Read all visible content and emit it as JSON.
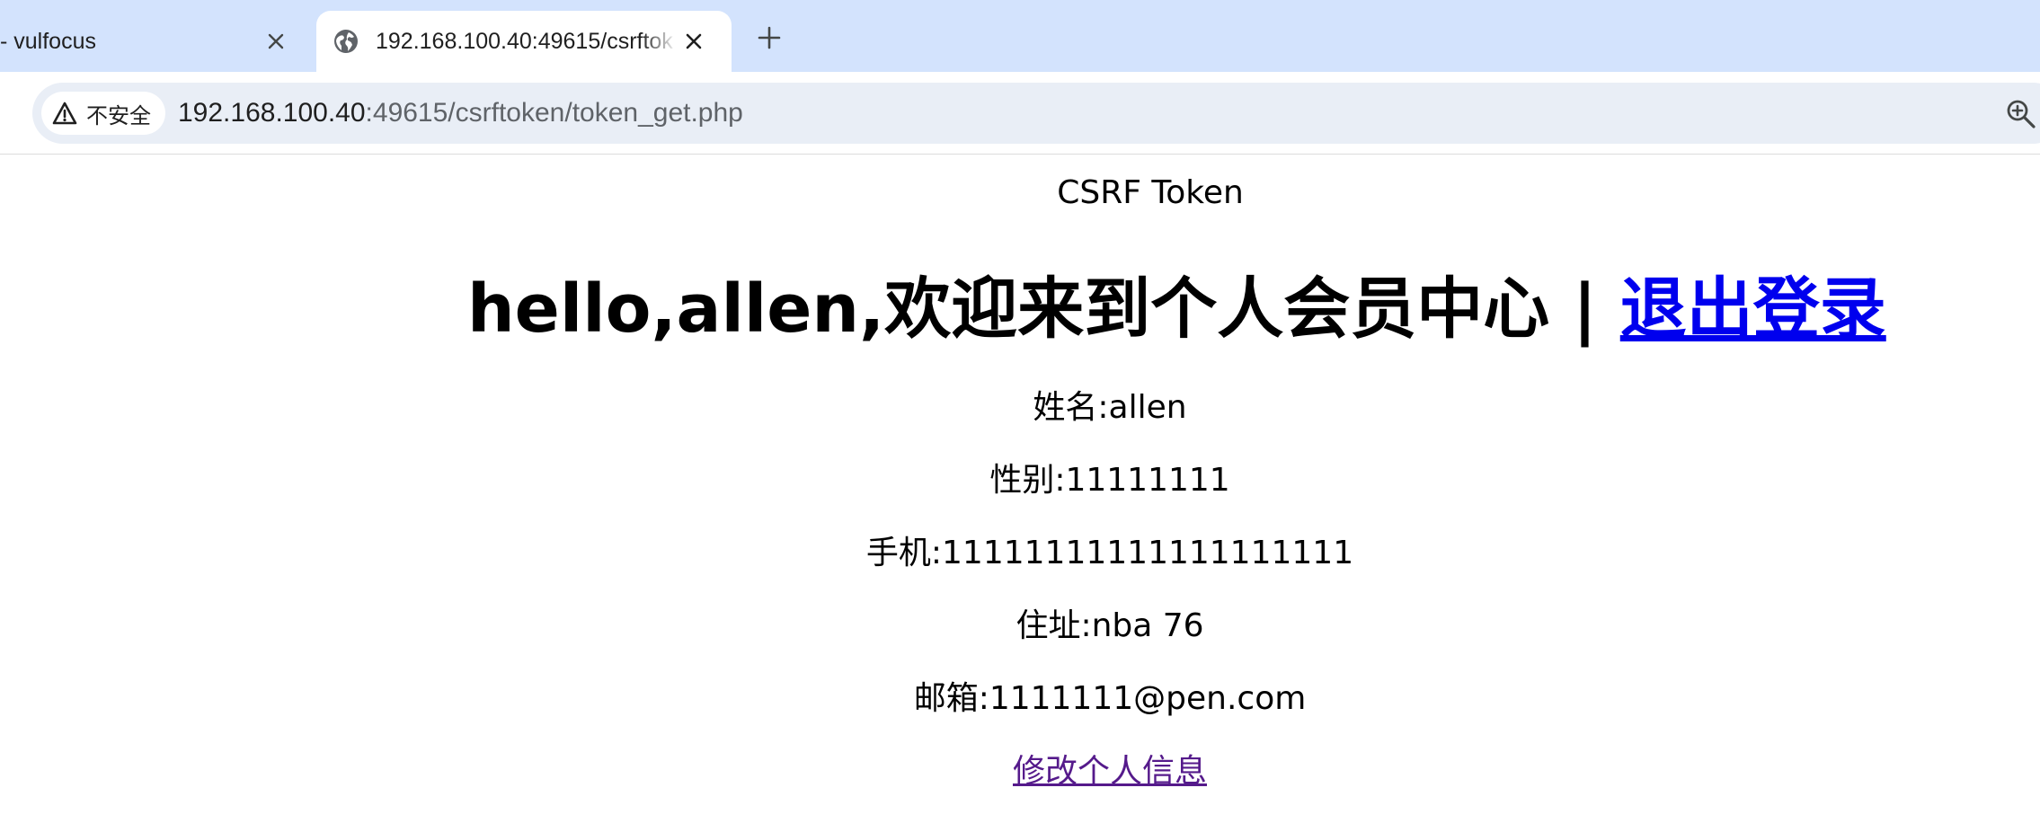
{
  "browser": {
    "tabs": [
      {
        "title": "- vulfocus",
        "active": false
      },
      {
        "title": "192.168.100.40:49615/csrftok",
        "active": true
      }
    ],
    "security_chip": "不安全",
    "url_host": "192.168.100.40",
    "url_rest": ":49615/csrftoken/token_get.php",
    "icons": {
      "close": "close-icon",
      "globe": "globe-icon",
      "new_tab": "plus-icon",
      "warning": "warning-icon",
      "zoom": "zoom-in-icon",
      "menu": "chevron-down-icon"
    }
  },
  "page": {
    "title": "CSRF Token",
    "welcome_prefix": "hello,allen,欢迎来到个人会员中心 | ",
    "logout_link": "退出登录",
    "name": "姓名:allen",
    "sex": "性别:11111111",
    "phone": "手机:11111111111111111111",
    "address": "住址:nba 76",
    "email": "邮箱:1111111@pen.com",
    "edit_link": "修改个人信息"
  },
  "colors": {
    "tabstrip_bg": "#d3e3fd",
    "omnibox_bg": "#e9eef6",
    "link": "#0000ee",
    "visited_link": "#551a8b"
  }
}
